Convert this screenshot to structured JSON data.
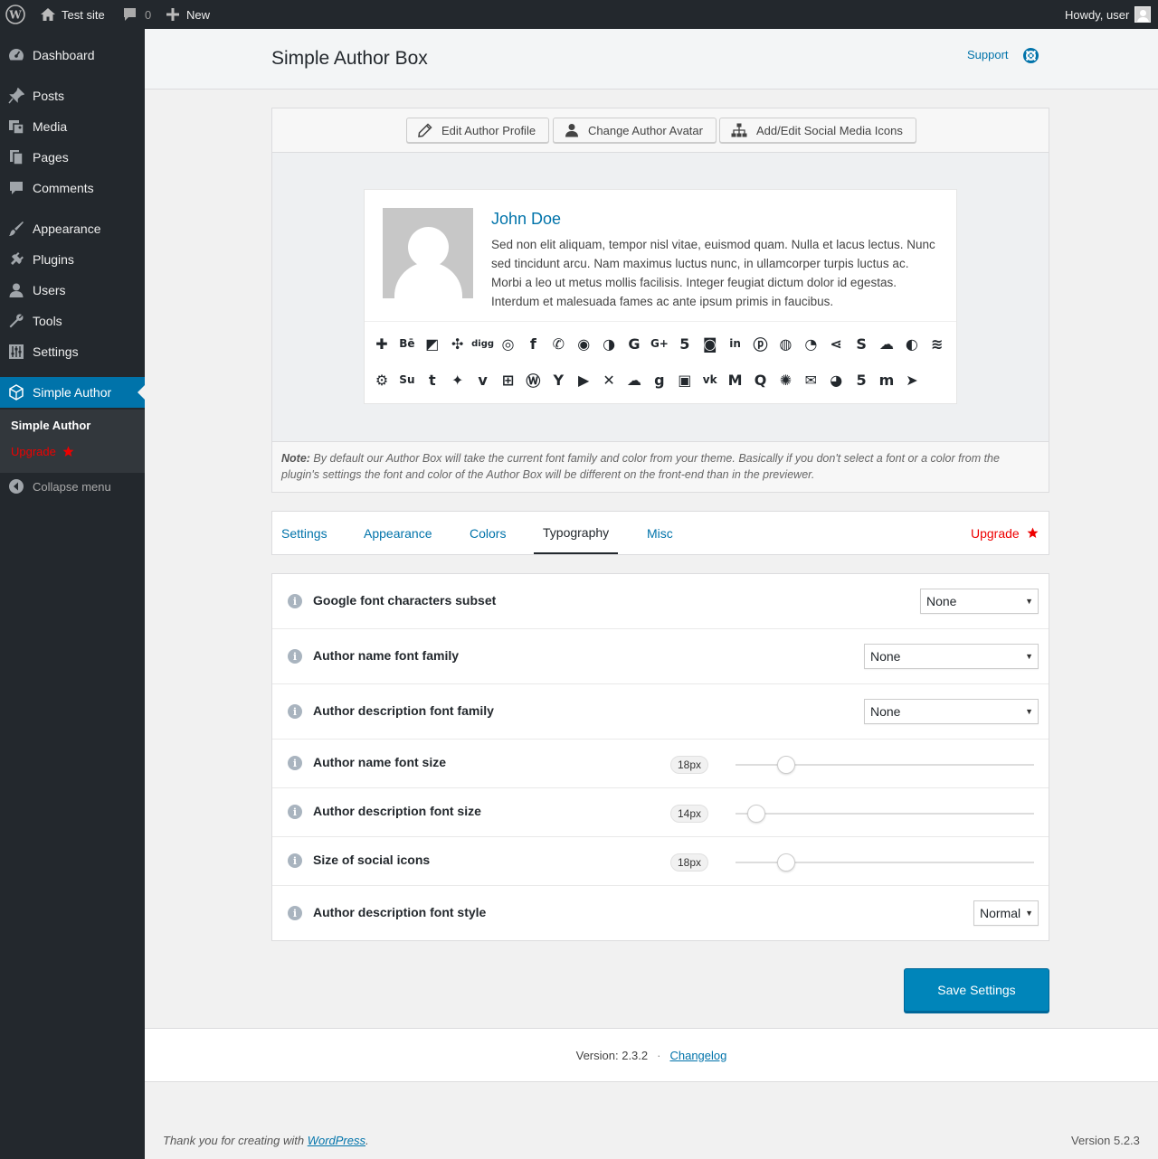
{
  "adminbar": {
    "site_name": "Test site",
    "comments_count": "0",
    "new_label": "New",
    "howdy": "Howdy, user"
  },
  "sidebar": {
    "items": [
      {
        "label": "Dashboard",
        "icon": "dashboard-icon"
      },
      {
        "label": "Posts",
        "icon": "pin-icon"
      },
      {
        "label": "Media",
        "icon": "media-icon"
      },
      {
        "label": "Pages",
        "icon": "pages-icon"
      },
      {
        "label": "Comments",
        "icon": "comment-icon"
      },
      {
        "label": "Appearance",
        "icon": "brush-icon"
      },
      {
        "label": "Plugins",
        "icon": "plug-icon"
      },
      {
        "label": "Users",
        "icon": "user-icon"
      },
      {
        "label": "Tools",
        "icon": "wrench-icon"
      },
      {
        "label": "Settings",
        "icon": "settings-sliders-icon"
      },
      {
        "label": "Simple Author",
        "icon": "cube-icon"
      }
    ],
    "submenu": {
      "simple_author": "Simple Author",
      "upgrade": "Upgrade"
    },
    "collapse": "Collapse menu"
  },
  "header": {
    "title": "Simple Author Box",
    "support": "Support"
  },
  "toolbar": {
    "edit_profile": "Edit Author Profile",
    "change_avatar": "Change Author Avatar",
    "social_icons": "Add/Edit Social Media Icons"
  },
  "authorbox": {
    "name": "John Doe",
    "description": "Sed non elit aliquam, tempor nisl vitae, euismod quam. Nulla et lacus lectus. Nunc sed tincidunt arcu. Nam maximus luctus nunc, in ullamcorper turpis luctus ac. Morbi a leo ut metus mollis facilisis. Integer feugiat dictum dolor id egestas. Interdum et malesuada fames ac ante ipsum primis in faucibus.",
    "social_icons": [
      "addthis",
      "behance",
      "delicious",
      "deviantart",
      "digg",
      "dribbble",
      "facebook",
      "whatsapp",
      "flickr",
      "github",
      "google",
      "googleplus",
      "html5",
      "instagram",
      "linkedin",
      "pinterest",
      "reddit",
      "rss",
      "sharethis",
      "skype",
      "soundcloud",
      "spotify",
      "stackoverflow",
      "steam",
      "stumbleupon",
      "tumblr",
      "twitter",
      "vimeo",
      "windows",
      "wordpress",
      "yahoo",
      "youtube",
      "xing",
      "mixcloud",
      "goodreads",
      "twitch",
      "vk",
      "medium",
      "quora",
      "meetup",
      "email",
      "snapchat",
      "500px",
      "mastodon",
      "telegram"
    ]
  },
  "note": {
    "label": "Note:",
    "text": " By default our Author Box will take the current font family and color from your theme. Basically if you don't select a font or a color from the plugin's settings the font and color of the Author Box will be different on the front-end than in the previewer."
  },
  "tabs": [
    "Settings",
    "Appearance",
    "Colors",
    "Typography",
    "Misc"
  ],
  "active_tab": "Typography",
  "upgrade_tab": "Upgrade",
  "settings": {
    "subset": {
      "label": "Google font characters subset",
      "value": "None"
    },
    "name_family": {
      "label": "Author name font family",
      "value": "None"
    },
    "desc_family": {
      "label": "Author description font family",
      "value": "None"
    },
    "name_size": {
      "label": "Author name font size",
      "value": "18px",
      "level": 0.17
    },
    "desc_size": {
      "label": "Author description font size",
      "value": "14px",
      "level": 0.07
    },
    "icon_size": {
      "label": "Size of social icons",
      "value": "18px",
      "level": 0.17
    },
    "desc_style": {
      "label": "Author description font style",
      "value": "Normal"
    }
  },
  "save": "Save Settings",
  "version": {
    "text": "Version: 2.3.2",
    "sep": "·",
    "changelog": "Changelog"
  },
  "footer": {
    "thanks": "Thank you for creating with ",
    "wordpress": "WordPress",
    "period": ".",
    "wp_version": "Version 5.2.3"
  },
  "colors": {
    "accent": "#0073aa",
    "upgrade": "#ee0000",
    "sidebar": "#23282d"
  }
}
